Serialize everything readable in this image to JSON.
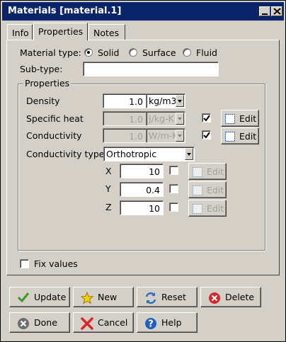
{
  "window": {
    "title": "Materials [material.1]"
  },
  "tabs": [
    {
      "label": "Info"
    },
    {
      "label": "Properties"
    },
    {
      "label": "Notes"
    }
  ],
  "material_type": {
    "label": "Material type:",
    "options": [
      {
        "label": "Solid",
        "checked": true
      },
      {
        "label": "Surface",
        "checked": false
      },
      {
        "label": "Fluid",
        "checked": false
      }
    ]
  },
  "subtype": {
    "label": "Sub-type:",
    "value": ""
  },
  "properties_group": {
    "title": "Properties"
  },
  "density": {
    "label": "Density",
    "value": "1.0",
    "unit": "kg/m3"
  },
  "specific_heat": {
    "label": "Specific heat",
    "value": "1.0",
    "unit": "J/kg-K",
    "checked": true,
    "edit_label": "Edit"
  },
  "conductivity": {
    "label": "Conductivity",
    "value": "1.0",
    "unit": "W/m-K",
    "checked": true,
    "edit_label": "Edit"
  },
  "conductivity_type": {
    "label": "Conductivity type",
    "value": "Orthotropic"
  },
  "axes": [
    {
      "label": "X",
      "value": "10",
      "edit_label": "Edit"
    },
    {
      "label": "Y",
      "value": "0.4",
      "edit_label": "Edit"
    },
    {
      "label": "Z",
      "value": "10",
      "edit_label": "Edit"
    }
  ],
  "fix_values": {
    "label": "Fix values",
    "checked": false
  },
  "buttons": {
    "update": "Update",
    "new": "New",
    "reset": "Reset",
    "delete": "Delete",
    "done": "Done",
    "cancel": "Cancel",
    "help": "Help"
  }
}
